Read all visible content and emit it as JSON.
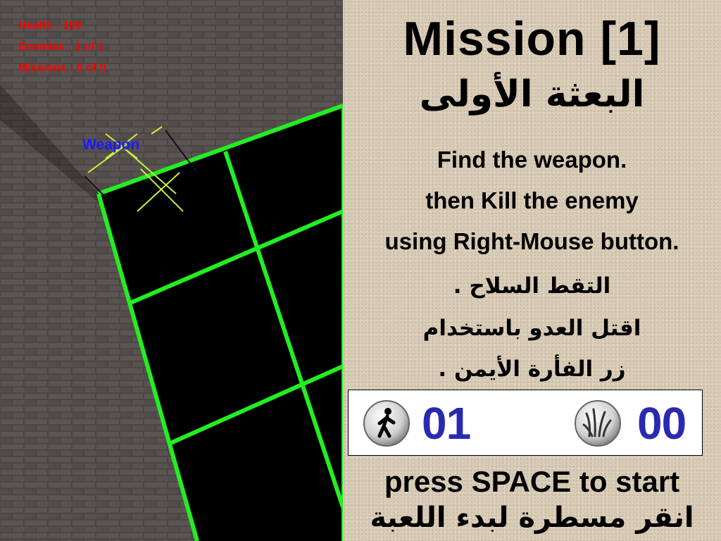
{
  "hud": {
    "health": "Health : 100",
    "enemies": "Enemies : 1 of 1",
    "missions": "Missions : 0 of 0",
    "color": "#ff0000"
  },
  "world": {
    "weapon_label": "Weapon",
    "weapon_label_color": "#1a1aff",
    "floor_grid_color": "#22ee22"
  },
  "briefing": {
    "title": "Mission [1]",
    "title_ar": "البعثة الأولى",
    "instructions": [
      "Find the weapon.",
      "then Kill the enemy",
      "using Right-Mouse button."
    ],
    "instructions_ar": [
      "التقط السلاح .",
      "اقتل العدو باستخدام",
      "زر الفأرة الأيمن ."
    ],
    "counters": {
      "enemies": {
        "icon": "walking-person-icon",
        "value": "01"
      },
      "missions": {
        "icon": "grass-icon",
        "value": "00"
      },
      "value_color": "#2a2ab0"
    },
    "start_prompt": "press SPACE to start",
    "start_prompt_ar": "انقر مسطرة لبدء اللعبة"
  }
}
